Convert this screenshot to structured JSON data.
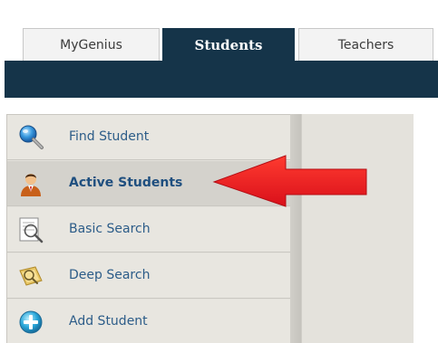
{
  "tabs": [
    {
      "label": "MyGenius",
      "active": false
    },
    {
      "label": "Students",
      "active": true
    },
    {
      "label": "Teachers",
      "active": false
    }
  ],
  "menu": {
    "items": [
      {
        "label": "Find Student",
        "icon": "magnifier-icon",
        "active": false
      },
      {
        "label": "Active Students",
        "icon": "student-avatar-icon",
        "active": true
      },
      {
        "label": "Basic Search",
        "icon": "basic-search-icon",
        "active": false
      },
      {
        "label": "Deep Search",
        "icon": "deep-search-icon",
        "active": false
      },
      {
        "label": "Add Student",
        "icon": "add-icon",
        "active": false
      }
    ]
  },
  "colors": {
    "navbar": "#153449",
    "menu_bg": "#e4e2dc",
    "active_row": "#d4d2cc",
    "link_text": "#2c5c88",
    "arrow": "#e8141b"
  }
}
